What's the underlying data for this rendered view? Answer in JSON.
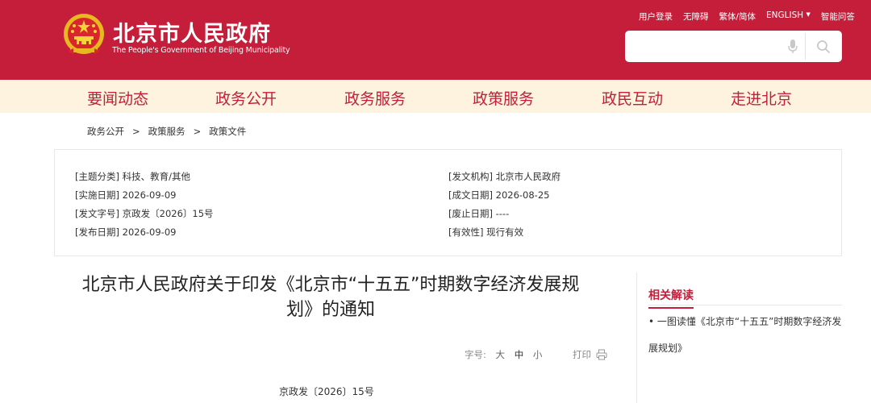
{
  "header": {
    "title_cn": "北京市人民政府",
    "title_en": "The People's Government of Beijing Municipality",
    "top_links": [
      "用户登录",
      "无障碍",
      "繁体/简体",
      "ENGLISH",
      "智能问答"
    ],
    "search_placeholder": ""
  },
  "nav": {
    "items": [
      "要闻动态",
      "政务公开",
      "政务服务",
      "政策服务",
      "政民互动",
      "走进北京"
    ]
  },
  "breadcrumb": [
    "政务公开",
    "政策服务",
    "政策文件"
  ],
  "breadcrumb_sep": ">",
  "info": {
    "left": [
      "[主题分类] 科技、教育/其他",
      "[实施日期] 2026-09-09",
      "[发文字号] 京政发〔2026〕15号",
      "[发布日期] 2026-09-09"
    ],
    "right": [
      "[发文机构] 北京市人民政府",
      "[成文日期] 2026-08-25",
      "[废止日期] ----",
      "[有效性] 现行有效"
    ]
  },
  "article": {
    "title_line1": "北京市人民政府关于印发《北京市“十五五”时期数字经济发展规",
    "title_line2": "划》的通知",
    "font_label": "字号:",
    "font_sizes": [
      "大",
      "中",
      "小"
    ],
    "print_label": "打印",
    "doc_number": "京政发〔2026〕15号"
  },
  "sidebar": {
    "heading": "相关解读",
    "items": [
      "• 一图读懂《北京市“十五五”时期数字经济发展规划》"
    ]
  },
  "colors": {
    "brand_red": "#c41e3a",
    "nav_bg": "#fdf3de"
  },
  "icons": [
    "national-emblem-icon",
    "microphone-icon",
    "search-icon",
    "printer-icon"
  ]
}
